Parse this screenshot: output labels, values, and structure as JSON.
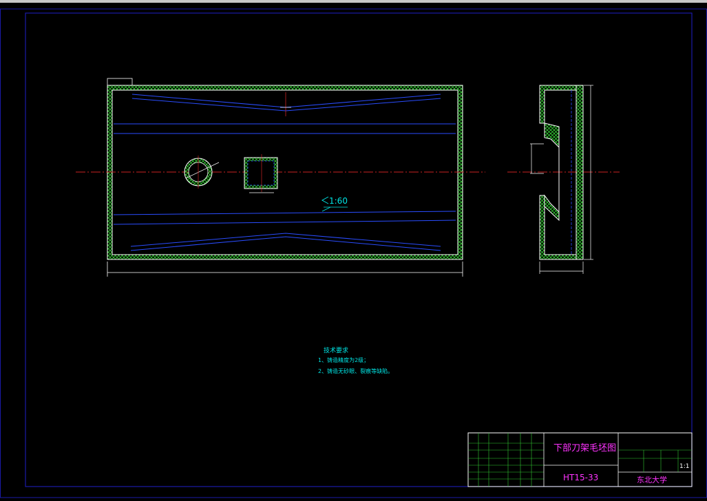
{
  "drawing": {
    "slope_annotation": "1:60",
    "tech_notes": {
      "title": "技术要求",
      "items": [
        "1、铸造精度为2级；",
        "2、铸造无砂眼、裂痕等缺陷。"
      ]
    },
    "title_block": {
      "drawing_name": "下部刀架毛坯图",
      "material": "HT15-33",
      "scale": "1:1",
      "school": "东北大学"
    }
  },
  "colors": {
    "border": "#1a1aa8",
    "outline": "#ffffff",
    "hatch": "#33cc33",
    "hidden_lines": "#2a4dff",
    "centerline": "#cc2222",
    "dimension": "#ffffff",
    "annotation_cyan": "#00e5e5",
    "title_magenta": "#ff33ff"
  }
}
